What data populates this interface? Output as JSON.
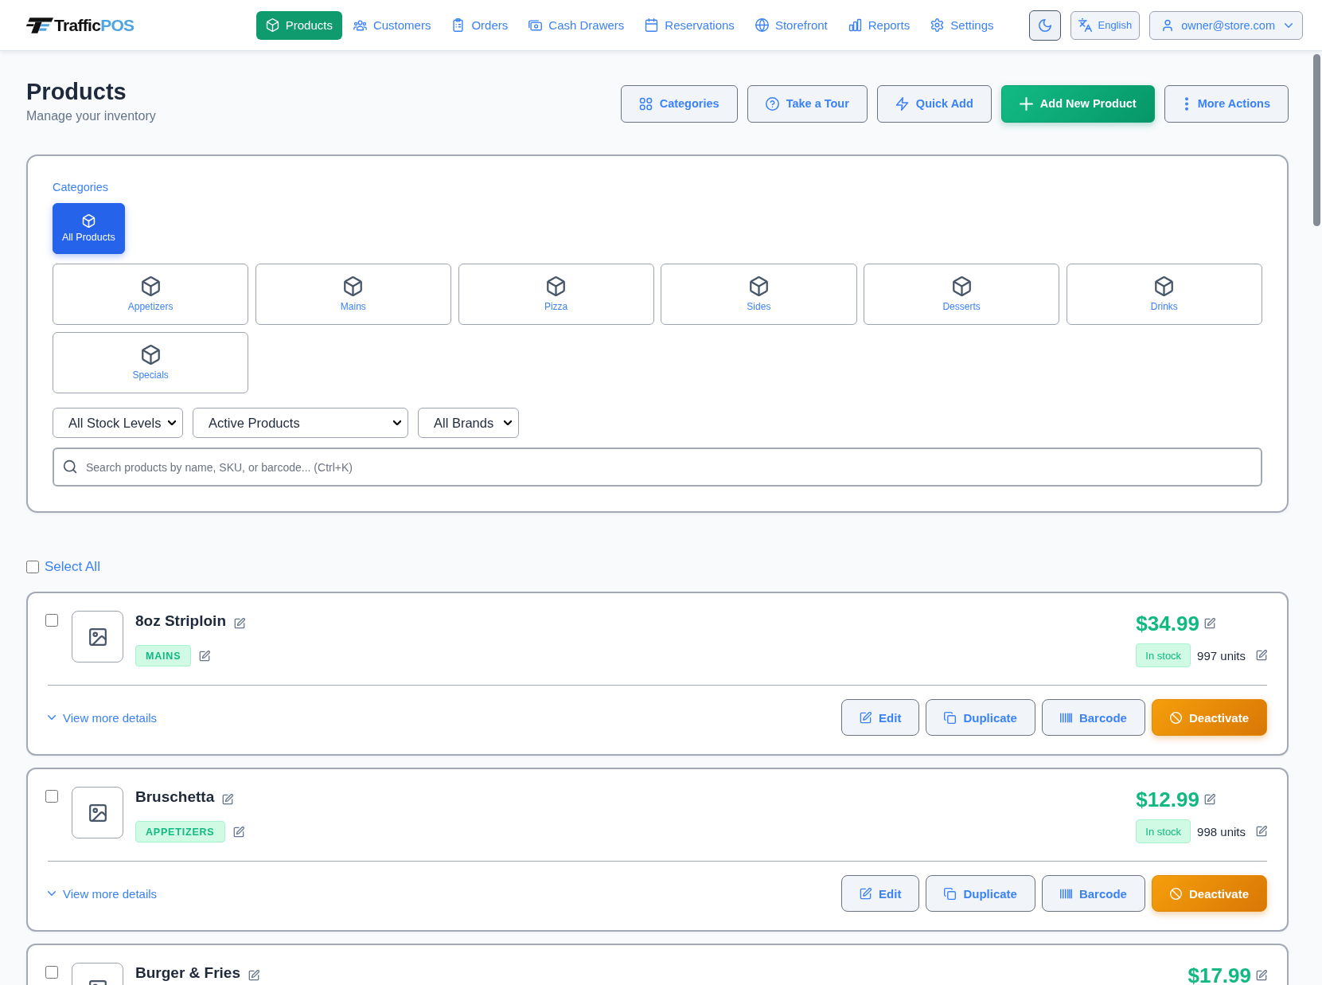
{
  "nav": {
    "brand": "Traffic",
    "brand_accent": "POS",
    "items": [
      {
        "label": "Products",
        "selected": true
      },
      {
        "label": "Customers",
        "selected": false
      },
      {
        "label": "Orders",
        "selected": false
      },
      {
        "label": "Cash Drawers",
        "selected": false
      },
      {
        "label": "Reservations",
        "selected": false
      },
      {
        "label": "Storefront",
        "selected": false
      },
      {
        "label": "Reports",
        "selected": false
      },
      {
        "label": "Settings",
        "selected": false
      }
    ],
    "language": "English",
    "user": "owner@store.com"
  },
  "header": {
    "title": "Products",
    "subtitle": "Manage your inventory",
    "actions": [
      {
        "label": "Categories",
        "kind": "outline"
      },
      {
        "label": "Take a Tour",
        "kind": "outline"
      },
      {
        "label": "Quick Add",
        "kind": "outline"
      },
      {
        "label": "Add New Product",
        "kind": "primary"
      },
      {
        "label": "More Actions",
        "kind": "outline"
      }
    ]
  },
  "filters": {
    "categories_label": "Categories",
    "categories": [
      {
        "label": "All Products",
        "kind": "all",
        "selected": true
      },
      {
        "label": "Appetizers",
        "kind": "category",
        "selected": false
      },
      {
        "label": "Mains",
        "kind": "category",
        "selected": false
      },
      {
        "label": "Pizza",
        "kind": "category",
        "selected": false
      },
      {
        "label": "Sides",
        "kind": "category",
        "selected": false
      },
      {
        "label": "Desserts",
        "kind": "category",
        "selected": false
      },
      {
        "label": "Drinks",
        "kind": "category",
        "selected": false
      },
      {
        "label": "Specials",
        "kind": "category",
        "selected": false
      }
    ],
    "dropdowns": [
      {
        "value": "All Stock Levels"
      },
      {
        "value": "Active Products"
      },
      {
        "value": "All Brands"
      }
    ],
    "search": {
      "placeholder": "Search products by name, SKU, or barcode... (Ctrl+K)"
    }
  },
  "select_all": {
    "label": "Select All",
    "checked": false
  },
  "products": [
    {
      "name": "8oz Striploin",
      "checked": false,
      "category": "MAINS",
      "price": "$34.99",
      "stock_status": "In stock",
      "units": "997 units",
      "details_link": "View more details",
      "expanded": false,
      "actions": [
        {
          "label": "Edit",
          "kind": "secondary"
        },
        {
          "label": "Duplicate",
          "kind": "secondary"
        },
        {
          "label": "Barcode",
          "kind": "secondary"
        },
        {
          "label": "Deactivate",
          "kind": "warning"
        }
      ]
    },
    {
      "name": "Bruschetta",
      "checked": false,
      "category": "APPETIZERS",
      "price": "$12.99",
      "stock_status": "In stock",
      "units": "998 units",
      "details_link": "View more details",
      "expanded": false,
      "actions": [
        {
          "label": "Edit",
          "kind": "secondary"
        },
        {
          "label": "Duplicate",
          "kind": "secondary"
        },
        {
          "label": "Barcode",
          "kind": "secondary"
        },
        {
          "label": "Deactivate",
          "kind": "warning"
        }
      ]
    },
    {
      "name": "Burger & Fries",
      "checked": false,
      "price": "$17.99"
    }
  ]
}
